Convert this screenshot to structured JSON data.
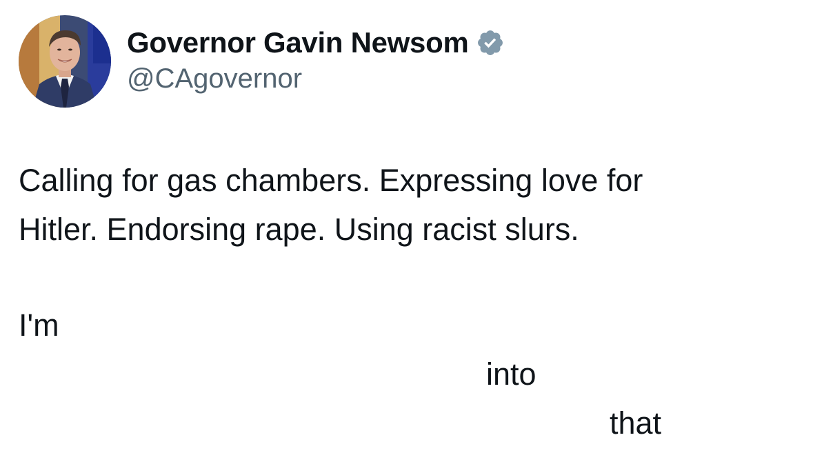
{
  "author": {
    "display_name": "Governor Gavin Newsom",
    "handle": "@CAgovernor",
    "verified_icon": "verified-badge-icon",
    "verified_color": "#829aab",
    "avatar": "profile-photo"
  },
  "tweet": {
    "lines": [
      "Calling for gas chambers. Expressing love for",
      "Hitler. Endorsing rape. Using racist slurs.",
      "I'm"
    ],
    "fragments": {
      "into": "into",
      "that": "that"
    }
  },
  "colors": {
    "text": "#0f1419",
    "secondary_text": "#536471",
    "background": "#ffffff"
  }
}
